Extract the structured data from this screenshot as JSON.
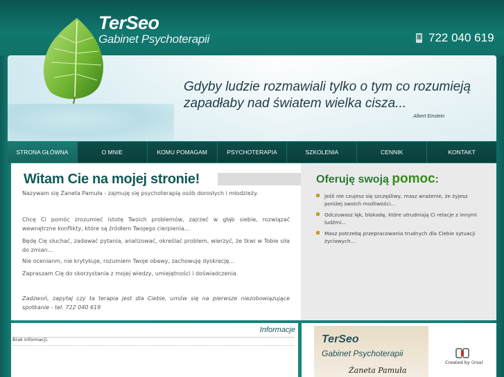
{
  "header": {
    "logo_title": "TerSeo",
    "logo_subtitle": "Gabinet Psychoterapii",
    "phone": "722 040 619",
    "phone_icon": "phone-icon"
  },
  "banner": {
    "quote_line1": "Gdyby ludzie rozmawiali tylko o tym co rozumieją",
    "quote_line2": "zapadłaby nad światem wielka cisza...",
    "author": "Albert Einstein"
  },
  "nav": {
    "items": [
      "STRONA GŁÓWNA",
      "O MNIE",
      "KOMU POMAGAM",
      "PSYCHOTERAPIA",
      "SZKOLENIA",
      "CENNIK",
      "KONTAKT"
    ],
    "active": "STRONA GŁÓWNA"
  },
  "welcome": {
    "heading": "Witam Cie na mojej stronie!",
    "intro": "Nazywam się Żaneta Pamuła - zajmuję się psychoterapią osób dorosłych i młodzieży.",
    "p1": "Chcę Ci pomóc zrozumieć istotę Twoich problemów, zajrzeć w głąb siebie, rozwiązać wewnętrzne konflikty, które są źródłem Twojego cierpienia...",
    "p2": "Będę Cię słuchać, zadawać pytania, analizować, określać problem, wierzyć, że tkwi w Tobie siła do zmian...",
    "p3": "Nie ocenianm, nie krytykuje, rozumiem Twoje obawy, zachowuję dyskrecję...",
    "p4": "Zapraszam Cię do skorzystania z mojej wiedzy, umiejętności i doświadczenia.",
    "p5": "Zadzwoń, zapytaj czy ta terapia jest dla Ciebie, umów się na pierwsze niezobowiązujące spotkanie - tel. 722 040 619"
  },
  "help": {
    "title_part1": "Oferuję swoją",
    "title_part2": "pomoc",
    "title_part3": ":",
    "items": [
      "Jeśli nie czujesz się szczęśliwy, masz wrażenie, że żyjesz poniżej swoich możliwości...",
      "Odczuwasz lęk, blokadę, które utrudniają Ci relacje z innymi ludźmi...",
      "Masz potrzebę przepracowania trudnych dla Ciebie sytuacji życiowych..."
    ]
  },
  "info": {
    "title": "Informacje",
    "text": "Brak informacji."
  },
  "card": {
    "title": "TerSeo",
    "subtitle": "Gabinet Psychoterapii",
    "signature": "Żaneta Pamuła"
  },
  "credits": {
    "text": "Created by (irsa)"
  },
  "colors": {
    "teal_bg": "#0d6e68",
    "nav_dark": "#0a3e3b",
    "heading_green": "#115a55",
    "help_green": "#3a8a1c"
  }
}
